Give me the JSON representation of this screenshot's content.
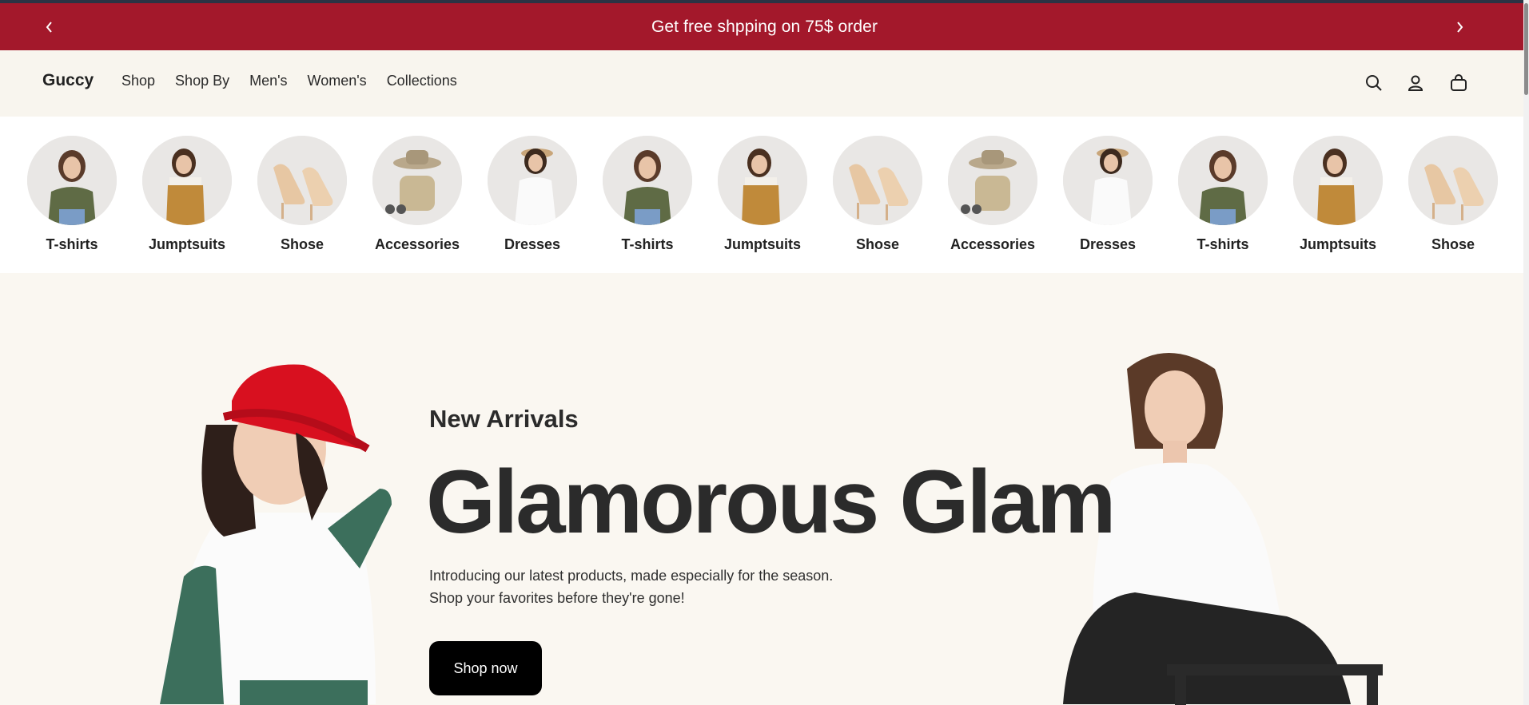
{
  "announcement": {
    "message": "Get free shpping on 75$ order"
  },
  "header": {
    "logo": "Guccy",
    "nav": [
      "Shop",
      "Shop By",
      "Men's",
      "Women's",
      "Collections"
    ]
  },
  "categories": [
    "T-shirts",
    "Jumptsuits",
    "Shose",
    "Accessories",
    "Dresses",
    "T-shirts",
    "Jumptsuits",
    "Shose",
    "Accessories",
    "Dresses",
    "T-shirts",
    "Jumptsuits",
    "Shose"
  ],
  "hero": {
    "eyebrow": "New Arrivals",
    "headline": "Glamorous Glam",
    "description_line1": "Introducing our latest products, made especially for the season.",
    "description_line2": "Shop your favorites before they're gone!",
    "cta": "Shop now"
  },
  "colors": {
    "announcement_bg": "#a3182b",
    "hat_red": "#d8101f",
    "pants_green": "#3f7360",
    "cta_bg": "#000000"
  }
}
